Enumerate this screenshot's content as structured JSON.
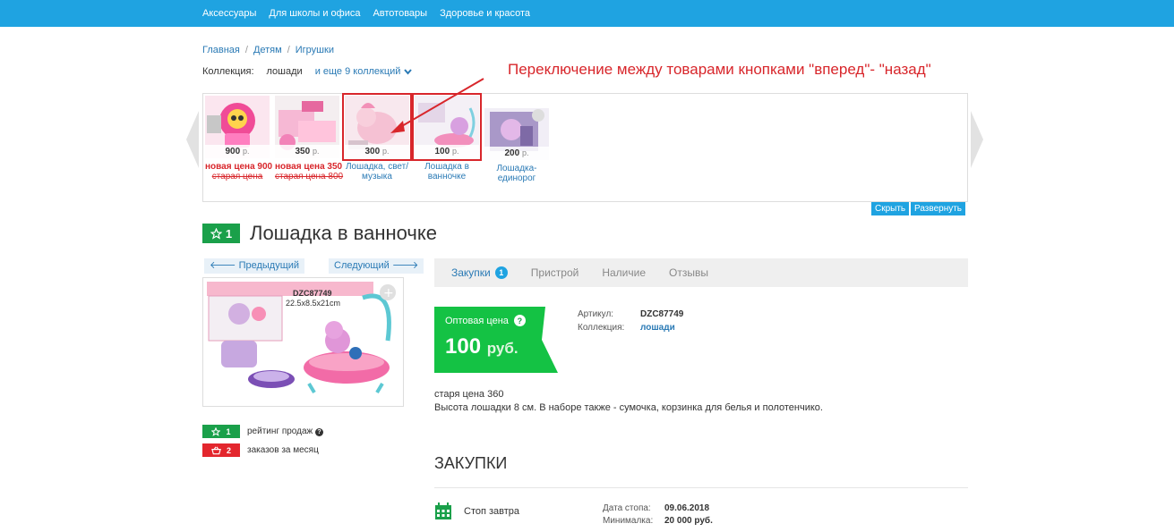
{
  "topnav": {
    "items": [
      "Аксессуары",
      "Для школы и офиса",
      "Автотовары",
      "Здоровье и красота"
    ]
  },
  "breadcrumb": [
    "Главная",
    "Детям",
    "Игрушки"
  ],
  "breadcrumb_sep": "/",
  "collection": {
    "label": "Коллекция:",
    "value": "лошади",
    "more": "и еще 9 коллекций"
  },
  "annotation": "Переключение между товарами кнопками \"вперед\"- \"назад\"",
  "carousel": {
    "items": [
      {
        "price": "900",
        "currency": "р.",
        "new_price": "новая цена 900",
        "old_price": "старая цена"
      },
      {
        "price": "350",
        "currency": "р.",
        "new_price": "новая цена 350",
        "old_price": "старая цена 800"
      },
      {
        "price": "300",
        "currency": "р.",
        "caption": "Лошадка, свет/ музыка"
      },
      {
        "price": "100",
        "currency": "р.",
        "caption": "Лошадка в ванночке"
      },
      {
        "price": "200",
        "currency": "р.",
        "caption": "Лошадка-единорог"
      }
    ],
    "hide_label": "Скрыть",
    "expand_label": "Развернуть"
  },
  "product": {
    "rating": "1",
    "title": "Лошадка в ванночке",
    "prev_label": "Предыдущий",
    "next_label": "Следующий",
    "image_text": {
      "code": "DZC87749",
      "size": "22.5x8.5x21cm"
    },
    "stats": [
      {
        "value": "1",
        "label": "рейтинг продаж",
        "color": "#1aa04a"
      },
      {
        "value": "2",
        "label": "заказов за месяц",
        "color": "#e3262d"
      }
    ]
  },
  "tabs": [
    {
      "label": "Закупки",
      "badge": "1",
      "active": true
    },
    {
      "label": "Пристрой"
    },
    {
      "label": "Наличие"
    },
    {
      "label": "Отзывы"
    }
  ],
  "pricebox": {
    "label": "Оптовая цена",
    "value": "100",
    "currency": "руб.",
    "color": "#14c244"
  },
  "attrs": {
    "article_label": "Артикул:",
    "article": "DZC87749",
    "collection_label": "Коллекция:",
    "collection": "лошади"
  },
  "description": {
    "line1": "старя цена 360",
    "line2": "Высота лошадки 8 см. В наборе также - сумочка, корзинка для белья и полотенчико."
  },
  "purchases": {
    "heading": "ЗАКУПКИ",
    "stop_label": "Стоп завтра",
    "date_label": "Дата стопа:",
    "date": "09.06.2018",
    "min_label": "Минималка:",
    "min": "20 000 руб."
  }
}
